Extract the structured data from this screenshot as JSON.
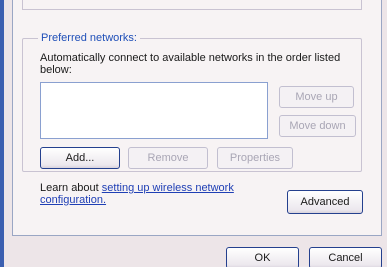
{
  "preferred_networks": {
    "legend": "Preferred networks:",
    "description": "Automatically connect to available networks in the order listed below:",
    "list_items": [],
    "buttons": {
      "move_up": "Move up",
      "move_down": "Move down",
      "add": "Add...",
      "remove": "Remove",
      "properties": "Properties"
    }
  },
  "learn": {
    "prefix": "Learn about ",
    "link": "setting up wireless network configuration."
  },
  "advanced_button": "Advanced",
  "footer": {
    "ok": "OK",
    "cancel": "Cancel"
  },
  "colors": {
    "legend": "#1f4fb8",
    "link": "#1f3fb5",
    "button_border": "#24408e",
    "window_frame": "#3b5fb0"
  }
}
